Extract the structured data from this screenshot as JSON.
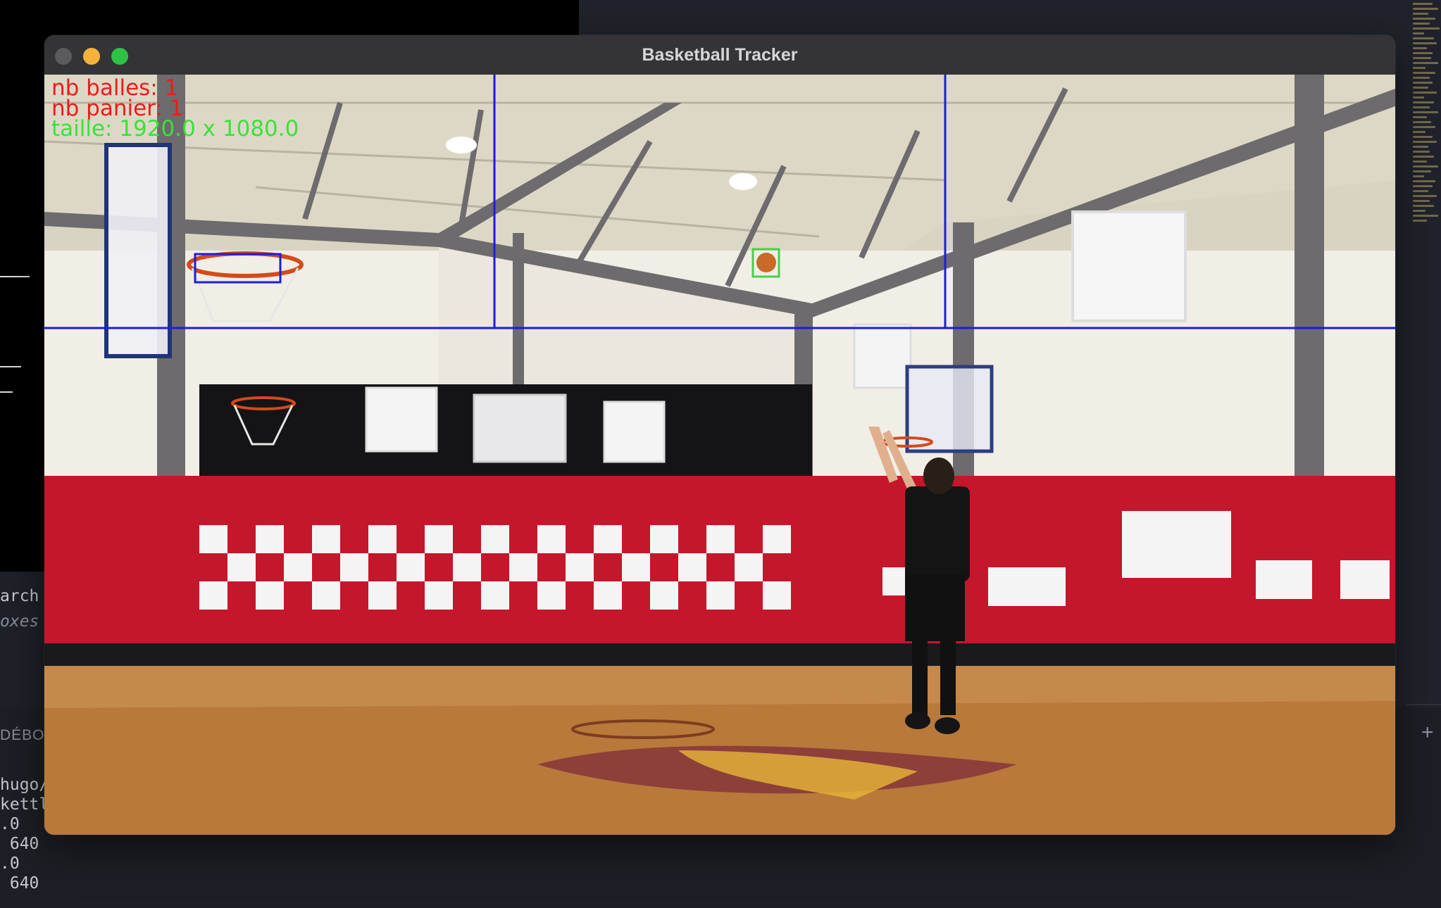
{
  "window": {
    "title": "Basketball Tracker"
  },
  "overlay": {
    "balls_label": "nb balles: 1",
    "baskets_label": "nb panier: 1",
    "size_label": "taille: 1920.0 x 1080.0",
    "colors": {
      "counts": "#f21a1a",
      "size": "#38e23b",
      "grid": "#1d1de0",
      "ball_box": "#46d04a",
      "hoop_box": "#1d1de0"
    }
  },
  "background": {
    "search_fragment": "arch",
    "boxes_fragment": "oxes",
    "debug_label": "DÉBOG",
    "console_lines": [
      "hugo/",
      "kettl",
      ".0",
      " 640",
      ".0",
      " 640"
    ]
  }
}
